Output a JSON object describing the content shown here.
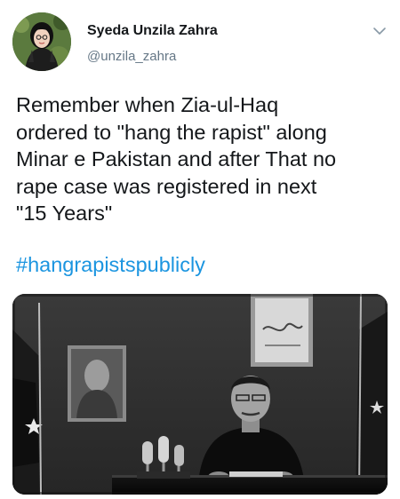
{
  "author": {
    "name": "Syeda Unzila Zahra",
    "handle": "@unzila_zahra",
    "avatar_icon": "avatar-portrait-icon"
  },
  "tweet": {
    "lines": [
      "Remember when Zia-ul-Haq",
      "ordered to \"hang the rapist\" along",
      "Minar e Pakistan and after That no",
      "rape case was registered in next",
      "\"15 Years\""
    ],
    "hashtag": "#hangrapistspublicly"
  },
  "menu": {
    "icon": "chevron-down-icon"
  },
  "colors": {
    "hashtag": "#1b95e0",
    "handle": "#657786",
    "text": "#14171a",
    "background": "#ffffff"
  }
}
